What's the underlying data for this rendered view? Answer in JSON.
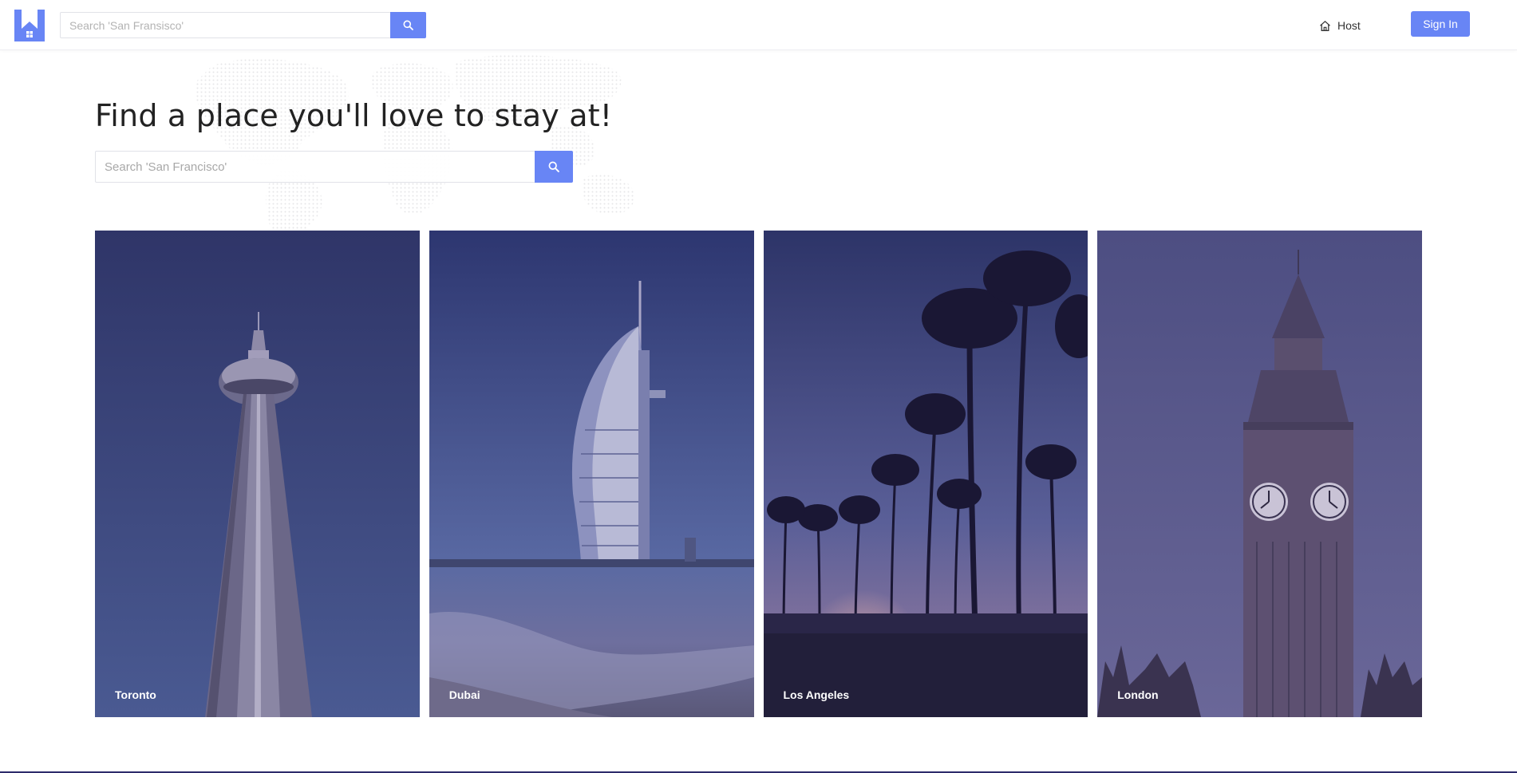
{
  "app": {
    "logo_icon": "house-h-logo-icon",
    "accent_color": "#6885f5"
  },
  "header": {
    "search_placeholder": "Search 'San Fransisco'",
    "search_icon": "search-icon",
    "host_label": "Host",
    "host_icon": "home-icon",
    "signin_label": "Sign In"
  },
  "hero": {
    "title": "Find a place you'll love to stay at!",
    "search_placeholder": "Search 'San Francisco'",
    "background_icon": "world-map-icon"
  },
  "cities": [
    {
      "label": "Toronto",
      "image": "cn-tower-image"
    },
    {
      "label": "Dubai",
      "image": "burj-al-arab-image"
    },
    {
      "label": "Los Angeles",
      "image": "palm-trees-image"
    },
    {
      "label": "London",
      "image": "big-ben-image"
    }
  ]
}
